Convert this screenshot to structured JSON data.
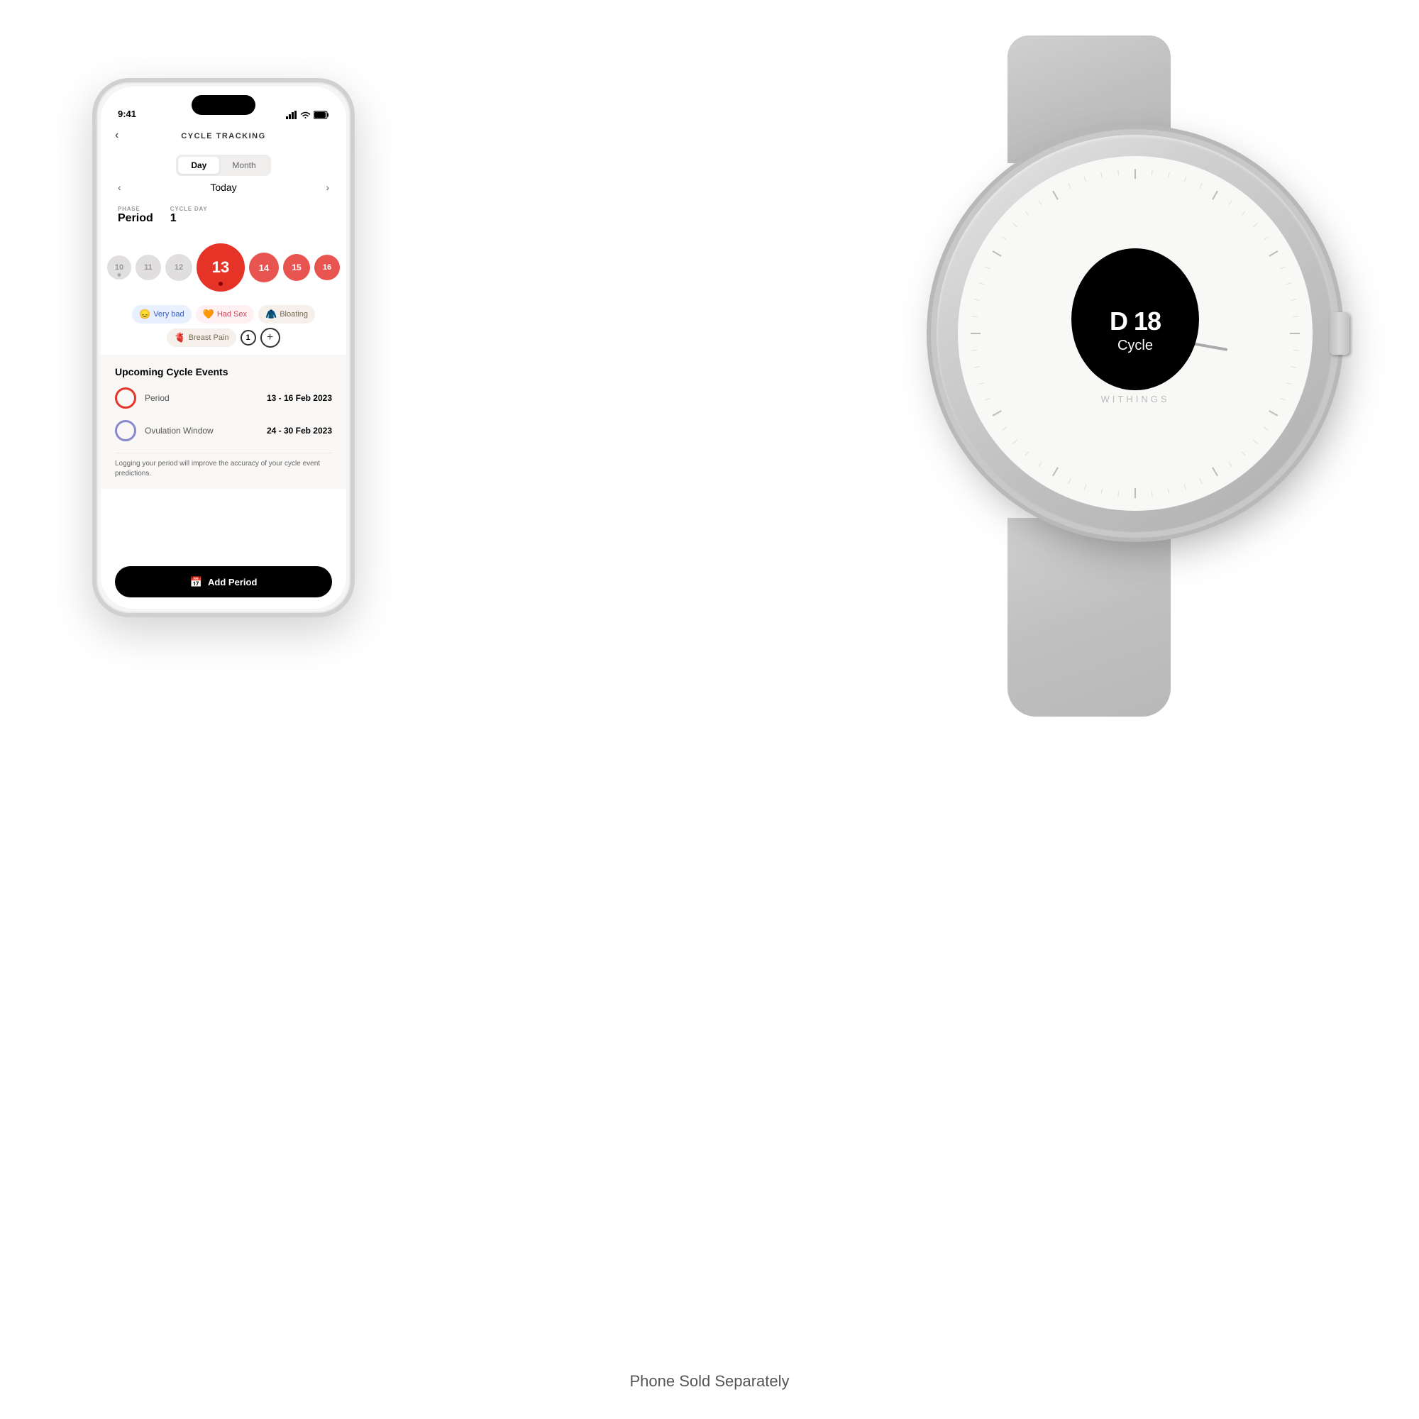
{
  "page": {
    "footer": "Phone Sold Separately"
  },
  "phone": {
    "status_bar": {
      "time": "9:41"
    },
    "header": {
      "back_label": "‹",
      "title": "CYCLE TRACKING"
    },
    "tabs": {
      "day_label": "Day",
      "month_label": "Month"
    },
    "navigation": {
      "prev": "‹",
      "label": "Today",
      "next": "›"
    },
    "phase": {
      "phase_label": "PHASE",
      "phase_value": "Period",
      "cycle_day_label": "CYCLE DAY",
      "cycle_day_value": "1"
    },
    "bubbles": [
      {
        "day": "10",
        "size": "small"
      },
      {
        "day": "11",
        "size": "small"
      },
      {
        "day": "12",
        "size": "small"
      },
      {
        "day": "13",
        "size": "large",
        "active": true
      },
      {
        "day": "14",
        "size": "medium"
      },
      {
        "day": "15",
        "size": "small-med"
      },
      {
        "day": "16",
        "size": "small"
      }
    ],
    "symptoms": [
      {
        "icon": "😞",
        "label": "Very bad",
        "type": "mood"
      },
      {
        "icon": "🧡",
        "label": "Had Sex",
        "type": "sex"
      },
      {
        "icon": "🧥",
        "label": "Bloating",
        "type": "bloating"
      },
      {
        "icon": "🫀",
        "label": "Breast Pain",
        "type": "breast"
      }
    ],
    "upcoming": {
      "title": "Upcoming Cycle Events",
      "period_label": "Period",
      "period_dates": "13 - 16 Feb 2023",
      "ovulation_label": "Ovulation Window",
      "ovulation_dates": "24 - 30 Feb 2023",
      "note": "Logging your period will improve the accuracy of your cycle event predictions."
    },
    "add_button": {
      "label": "Add Period"
    }
  },
  "watch": {
    "brand": "WITHINGS",
    "display": {
      "day_label": "D 18",
      "cycle_label": "Cycle"
    }
  }
}
